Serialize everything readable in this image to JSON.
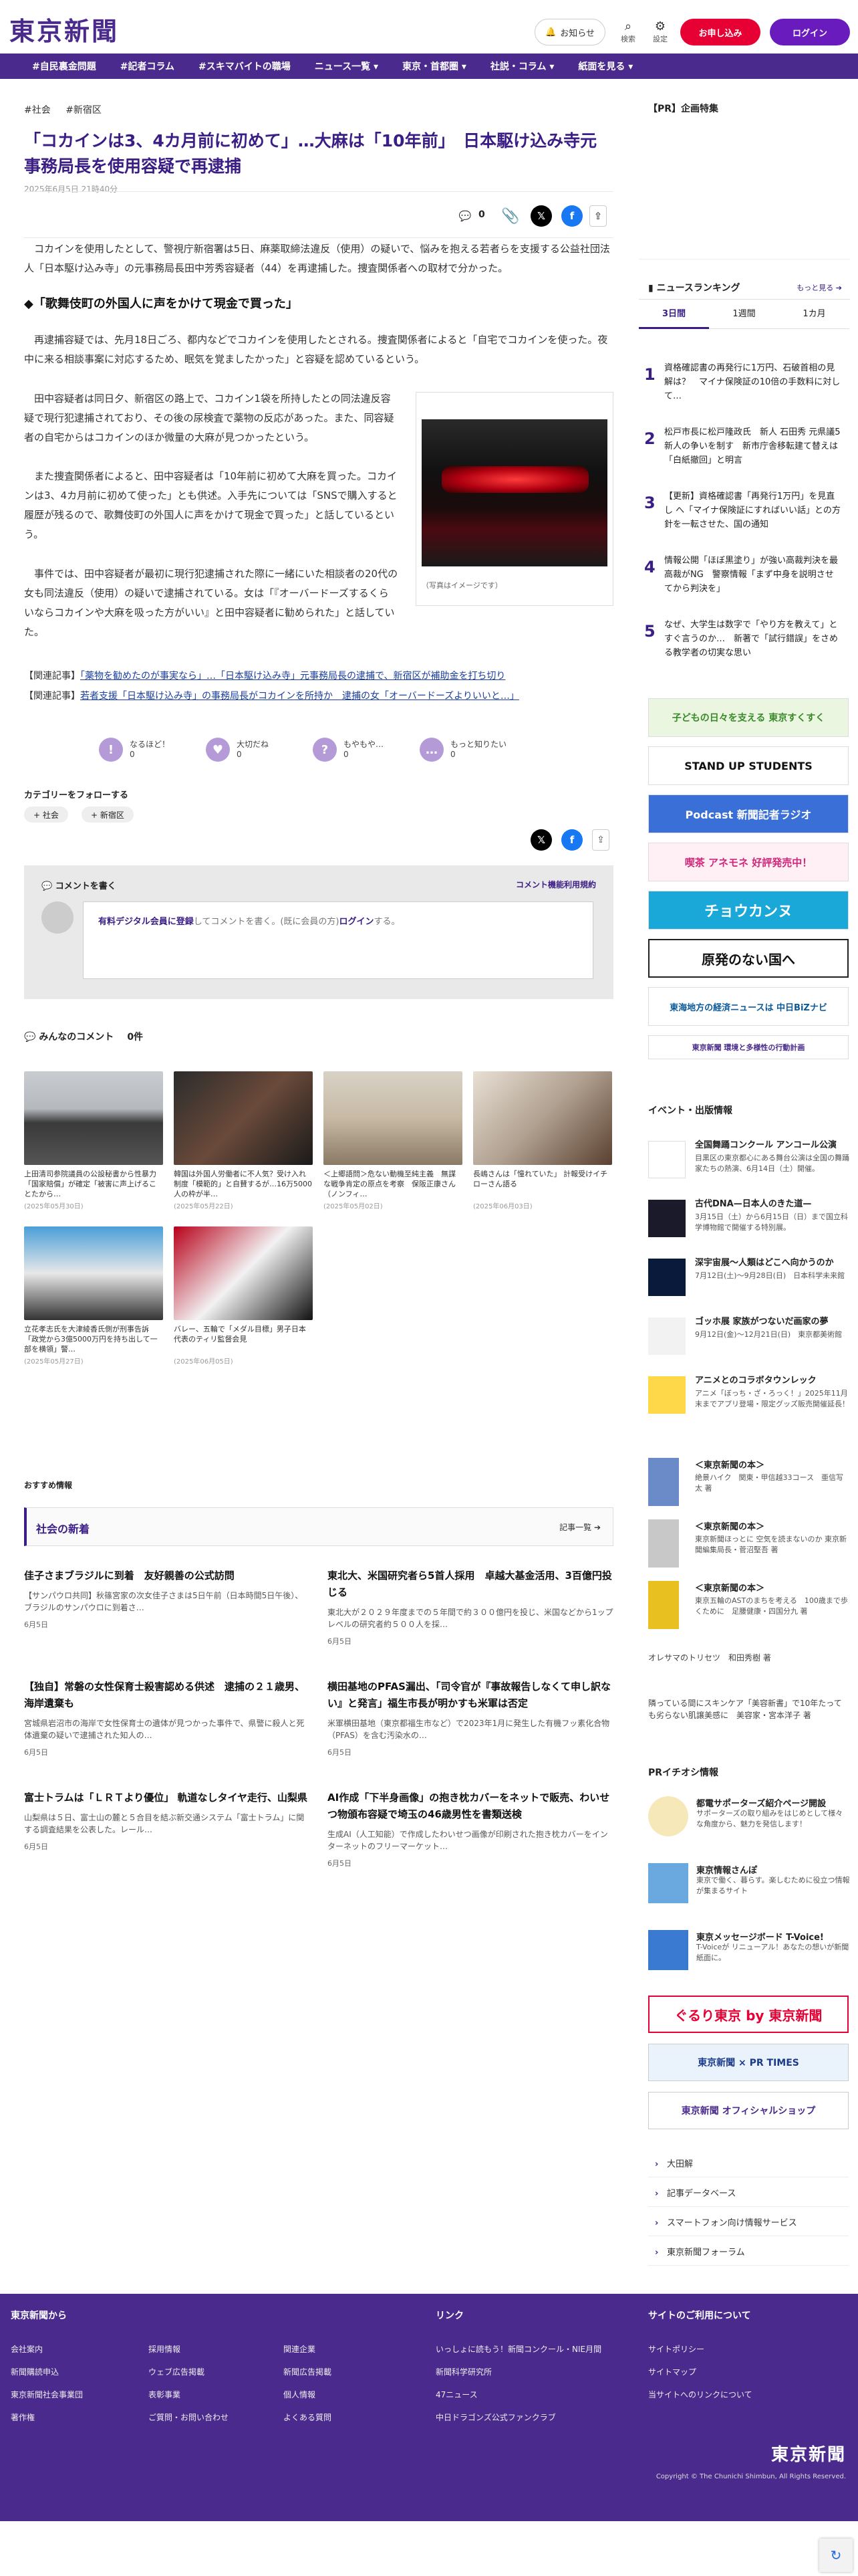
{
  "header": {
    "logo": "東京新聞",
    "notify_label": "お知らせ",
    "search_label": "検索",
    "settings_label": "設定",
    "trial_label": "お申し込み",
    "login_label": "ログイン"
  },
  "nav": {
    "items": [
      "#自民裏金問題",
      "#記者コラム",
      "#スキマバイトの職場",
      "ニュース一覧 ▾",
      "東京・首都圏 ▾",
      "社説・コラム ▾",
      "紙面を見る ▾"
    ]
  },
  "article": {
    "tags": [
      "#社会",
      "#新宿区"
    ],
    "title": "「コカインは3、4カ月前に初めて」…大麻は「10年前」　日本駆け込み寺元事務局長を使用容疑で再逮捕",
    "date": "2025年6月5日 21時40分",
    "comment_count": "0",
    "paragraphs": [
      "コカインを使用したとして、警視庁新宿署は5日、麻薬取締法違反（使用）の疑いで、悩みを抱える若者らを支援する公益社団法人「日本駆け込み寺」の元事務局長田中芳秀容疑者（44）を再逮捕した。捜査関係者への取材で分かった。",
      "再逮捕容疑では、先月18日ごろ、都内などでコカインを使用したとされる。捜査関係者によると「自宅でコカインを使った。夜中に来る相談事案に対応するため、眠気を覚ましたかった」と容疑を認めているという。",
      "田中容疑者は同日夕、新宿区の路上で、コカイン1袋を所持したとの同法違反容疑で現行犯逮捕されており、その後の尿検査で薬物の反応があった。また、同容疑者の自宅からはコカインのほか微量の大麻が見つかったという。",
      "また捜査関係者によると、田中容疑者は「10年前に初めて大麻を買った。コカインは3、4カ月前に初めて使った」とも供述。入手先については「SNSで購入すると履歴が残るので、歌舞伎町の外国人に声をかけて現金で買った」と話しているという。",
      "事件では、田中容疑者が最初に現行犯逮捕された際に一緒にいた相談者の20代の女も同法違反（使用）の疑いで逮捕されている。女は「『オーバードーズするくらいならコカインや大麻を吸った方がいい』と田中容疑者に勧められた」と話していた。"
    ],
    "subheading": "◆「歌舞伎町の外国人に声をかけて現金で買った」",
    "photo_caption": "（写真はイメージです）",
    "related_label": "【関連記事】",
    "related": [
      "「薬物を勧めたのが事実なら」…「日本駆け込み寺」元事務局長の逮捕で、新宿区が補助金を打ち切り",
      "若者支援「日本駆け込み寺」の事務局長がコカインを所持か　逮捕の女「オーバードーズよりいいと…」"
    ],
    "reactions": [
      {
        "icon": "!",
        "label1": "なるほど！",
        "label2": "0"
      },
      {
        "icon": "♥",
        "label1": "大切だね",
        "label2": "0"
      },
      {
        "icon": "?",
        "label1": "もやもや…",
        "label2": "0"
      },
      {
        "icon": "…",
        "label1": "もっと知りたい",
        "label2": "0"
      }
    ],
    "follow_label": "カテゴリーをフォローする",
    "follow_chips": [
      "+ 社会",
      "+ 新宿区"
    ]
  },
  "comments": {
    "write_label": "コメントを書く",
    "rules_label": "コメント機能利用規約",
    "input_text_1": "有料デジタル会員に登録",
    "input_text_2": "してコメントを書く。(既に会員の方)",
    "input_text_3": "ログイン",
    "input_text_4": "する。",
    "everyone_label": "みんなのコメント",
    "count": "0件"
  },
  "thumbs": [
    {
      "title": "上田清司参院議員の公設秘書から性暴力「国家賠償」が確定「被害に声上げることたから…",
      "date": "(2025年05月30日)"
    },
    {
      "title": "韓国は外国人労働者に不人気？受け入れ制度「模範的」と自賛するが…16万5000人の枠が半…",
      "date": "(2025年05月22日)"
    },
    {
      "title": "＜上郷語問＞危ない動機至純主義　無謀な戦争肯定の原点を考察　保阪正康さん（ノンフィ…",
      "date": "(2025年05月02日)"
    },
    {
      "title": "長嶋さんは「憧れていた」 計報受けイチローさん語る",
      "date": "(2025年06月03日)"
    },
    {
      "title": "立花孝志氏を大津綾香氏側が刑事告訴「政党から3億5000万円を持ち出して一部を横領」警…",
      "date": "(2025年05月27日)"
    },
    {
      "title": "バレー、五輪で「メダル目標」男子日本代表のティリ監督会見",
      "date": "(2025年06月05日)"
    }
  ],
  "recommend_label": "おすすめ情報",
  "society": {
    "heading": "社会の新着",
    "more": "記事一覧 ➔",
    "items": [
      {
        "title": "佳子さまブラジルに到着　友好親善の公式訪問",
        "summary": "【サンパウロ共同】秋篠宮家の次女佳子さまは5日午前（日本時間5日午後）、ブラジルのサンパウロに到着さ…",
        "date": "6月5日"
      },
      {
        "title": "東北大、米国研究者ら5首人採用　卓越大基金活用、3百億円投じる",
        "summary": "東北大が２０２９年度までの５年間で約３００億円を投じ、米国などから1ップレベルの研究者約５００人を採…",
        "date": "6月5日"
      },
      {
        "title": "【独自】常磐の女性保育士殺害認める供述　逮捕の２１歳男、海岸遺棄も",
        "summary": "宮城県岩沼市の海岸で女性保育士の遺体が見つかった事件で、県警に殺人と死体遺棄の疑いで逮捕された知人の…",
        "date": "6月5日"
      },
      {
        "title": "横田基地のPFAS漏出、「司令官が『事故報告しなくて申し訳ない』と発言」福生市長が明かすも米軍は否定",
        "summary": "米軍横田基地（東京都福生市など）で2023年1月に発生した有機フッ素化合物（PFAS）を含む汚染水の…",
        "date": "6月5日"
      },
      {
        "title": "富士トラムは「ＬＲＴより優位」 軌道なしタイヤ走行、山梨県",
        "summary": "山梨県は５日、富士山の麓と５合目を結ぶ新交通システム「富士トラム」に関する調査結果を公表した。レール…",
        "date": "6月5日"
      },
      {
        "title": "AI作成「下半身画像」の抱き枕カバーをネットで販売、わいせつ物頒布容疑で埼玉の46歳男性を書類送検",
        "summary": "生成AI（人工知能）で作成したわいせつ画像が印刷された抱き枕カバーをインターネットのフリーマーケット…",
        "date": "6月5日"
      }
    ]
  },
  "sidebar": {
    "pr_label": "【PR】企画特集",
    "ranking_label": "ニュースランキング",
    "ranking_more": "もっと見る ➔",
    "tabs": [
      "3日間",
      "1週間",
      "1カ月"
    ],
    "ranking": [
      {
        "n": "1",
        "t": "資格確認書の再発行に1万円、石破首相の見解は？　マイナ保険証の10倍の手数料に対して…"
      },
      {
        "n": "2",
        "t": "松戸市長に松戸隆政氏　新人 石田秀 元県議5新人の争いを制す　新市庁舎移転建て替えは「白紙撤回」と明言"
      },
      {
        "n": "3",
        "t": "【更新】資格確認書「再発行1万円」を見直し へ「マイナ保険証にすればいい話」との方針を一転させた、国の通知"
      },
      {
        "n": "4",
        "t": "情報公開「ほぼ黒塗り」が強い高裁判決を最高裁がNG　警察情報「まず中身を説明させてから判決を」"
      },
      {
        "n": "5",
        "t": "なぜ、大学生は数字で「やり方を教えて」とすぐ言うのか…　新著で「試行錯誤」をさめる教学者の切実な思い"
      }
    ],
    "banners": [
      "子どもの日々を支える 東京すくすく",
      "STAND UP STUDENTS",
      "Podcast 新聞記者ラジオ",
      "喫茶 アネモネ 好評発売中！",
      "チョウカンヌ",
      "原発のない国へ",
      "東海地方の経済ニュースは 中日BiZナビ",
      "東京新聞 環境と多様性の行動計画"
    ],
    "events_label": "イベント・出版情報",
    "events": [
      {
        "t": "全国舞踊コンクール アンコール公演",
        "s": "目黒区の東京都心にある舞台公演は全国の舞踊家たちの熱演、6月14日（土）開催。"
      },
      {
        "t": "古代DNA—日本人のきた道—",
        "s": "3月15日（土）から6月15日（日）まで国立科学博物館で開催する特別展。"
      },
      {
        "t": "深宇宙展〜人類はどこへ向かうのか",
        "s": "7月12日(土)〜9月28日(日)　日本科学未来館"
      },
      {
        "t": "ゴッホ展 家族がつないだ画家の夢",
        "s": "9月12日(金)〜12月21日(日)　東京都美術館"
      },
      {
        "t": "アニメとのコラボタウンレック",
        "s": "アニメ「ぼっち・ざ・ろっく！」2025年11月末までアプリ登場・限定グッズ販売開催延長！"
      }
    ],
    "books": [
      {
        "t": "＜東京新聞の本＞",
        "s": "絶景ハイク　関東・甲信越33コース　亜信写太 著"
      },
      {
        "t": "＜東京新聞の本＞",
        "s": "東京新聞ほっとに 空気を読まないのか 東京新聞編集局長・菅沼堅吾 著"
      },
      {
        "t": "＜東京新聞の本＞",
        "s": "東京五輪のASTのまちを考える　100歳まで歩くために　足腰健康・四国分九 著"
      }
    ],
    "links": [
      "オレサマのトリセツ　和田秀樹 著",
      "隣っている間にスキンケア「美容新書」で10年たっても劣らない肌譲美感に　美容家・宮本洋子 著"
    ],
    "pr_info_label": "PRイチオシ情報",
    "pr_items": [
      {
        "t": "都電サポーターズ紹介ページ開設",
        "s": "サポーターズの取り組みをはじめとして様々な角度から、魅力を発信します！"
      },
      {
        "t": "東京情報さんぽ",
        "s": "東京で働く、暮らす。楽しむために役立つ情報が集まるサイト"
      },
      {
        "t": "東京メッセージボード T-Voice!",
        "s": "T-Voiceが リニューアル！あなたの想いが新聞紙面に。"
      }
    ],
    "bottom_banners": [
      "ぐるり東京 by 東京新聞",
      "東京新聞 × PR TIMES",
      "東京新聞 オフィシャルショップ"
    ],
    "menu": [
      "大田解",
      "記事データベース",
      "スマートフォン向け情報サービス",
      "東京新聞フォーラム"
    ]
  },
  "footer": {
    "col1_title": "東京新聞から",
    "col1": [
      "会社案内",
      "新聞購読申込",
      "東京新聞社会事業団",
      "著作権"
    ],
    "col1b": [
      "採用情報",
      "ウェブ広告掲載",
      "表彰事業",
      "ご質問・お問い合わせ"
    ],
    "col1c": [
      "関連企業",
      "新聞広告掲載",
      "個人情報",
      "よくある質問"
    ],
    "col2_title": "リンク",
    "col2": [
      "いっしょに読もう！新聞コンクール・NIE月間",
      "新聞科学研究所",
      "47ニュース",
      "中日ドラゴンズ公式ファンクラブ"
    ],
    "col3_title": "サイトのご利用について",
    "col3": [
      "サイトポリシー",
      "サイトマップ",
      "当サイトへのリンクについて"
    ],
    "logo": "東京新聞",
    "copyright": "Copyright © The Chunichi Shimbun, All Rights Reserved."
  },
  "colors": {
    "brand": "#4a2a8c",
    "accent": "#e60033"
  }
}
